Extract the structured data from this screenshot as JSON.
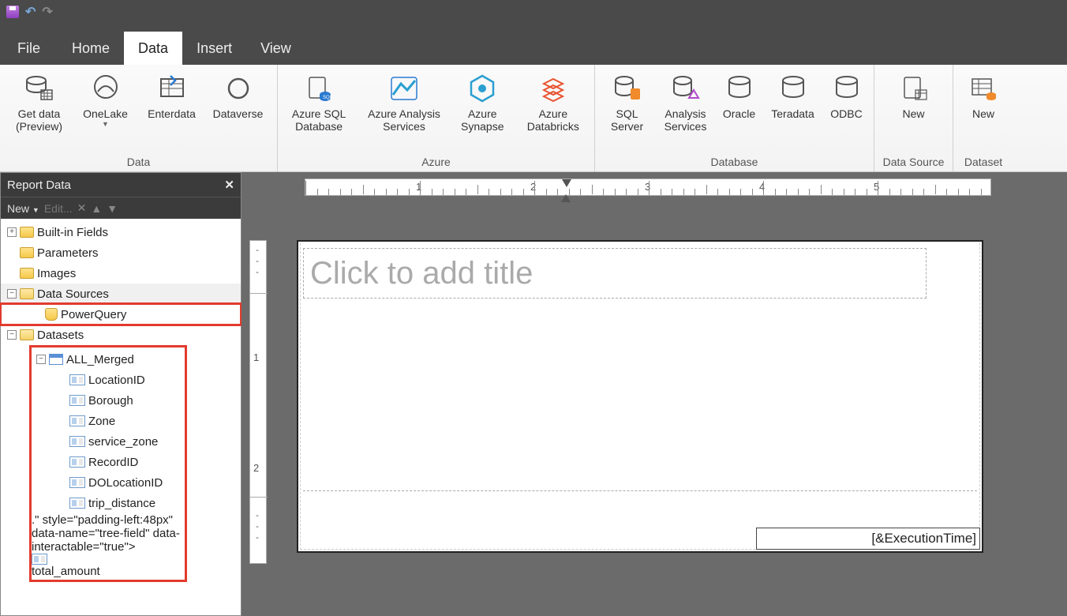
{
  "qat": {
    "save": "save",
    "undo": "undo",
    "redo": "redo"
  },
  "menu": {
    "file": "File",
    "home": "Home",
    "data": "Data",
    "insert": "Insert",
    "view": "View"
  },
  "ribbon_groups": {
    "data": {
      "label": "Data",
      "getdata": "Get data\n(Preview)",
      "onelake": "OneLake",
      "enterdata": "Enterdata",
      "dataverse": "Dataverse"
    },
    "azure": {
      "label": "Azure",
      "sqldb": "Azure SQL\nDatabase",
      "analysis": "Azure Analysis\nServices",
      "synapse": "Azure\nSynapse",
      "databricks": "Azure\nDatabricks"
    },
    "database": {
      "label": "Database",
      "sqlserver": "SQL\nServer",
      "analysissvc": "Analysis\nServices",
      "oracle": "Oracle",
      "teradata": "Teradata",
      "odbc": "ODBC"
    },
    "datasource": {
      "label": "Data Source",
      "new": "New"
    },
    "dataset": {
      "label": "Dataset",
      "new": "New"
    }
  },
  "panel": {
    "title": "Report Data",
    "new": "New",
    "edit": "Edit...",
    "tree": {
      "builtin": "Built-in Fields",
      "parameters": "Parameters",
      "images": "Images",
      "datasources": "Data Sources",
      "powerquery": "PowerQuery",
      "datasets": "Datasets",
      "allmerged": "ALL_Merged",
      "fields": [
        "LocationID",
        "Borough",
        "Zone",
        "service_zone",
        "RecordID",
        "DOLocationID",
        "trip_distance",
        "total_amount"
      ]
    }
  },
  "canvas": {
    "title_placeholder": "Click to add title",
    "execution": "[&ExecutionTime]",
    "ruler_nums": [
      "1",
      "2",
      "3",
      "4",
      "5"
    ],
    "vruler_nums": [
      "1",
      "2"
    ]
  }
}
